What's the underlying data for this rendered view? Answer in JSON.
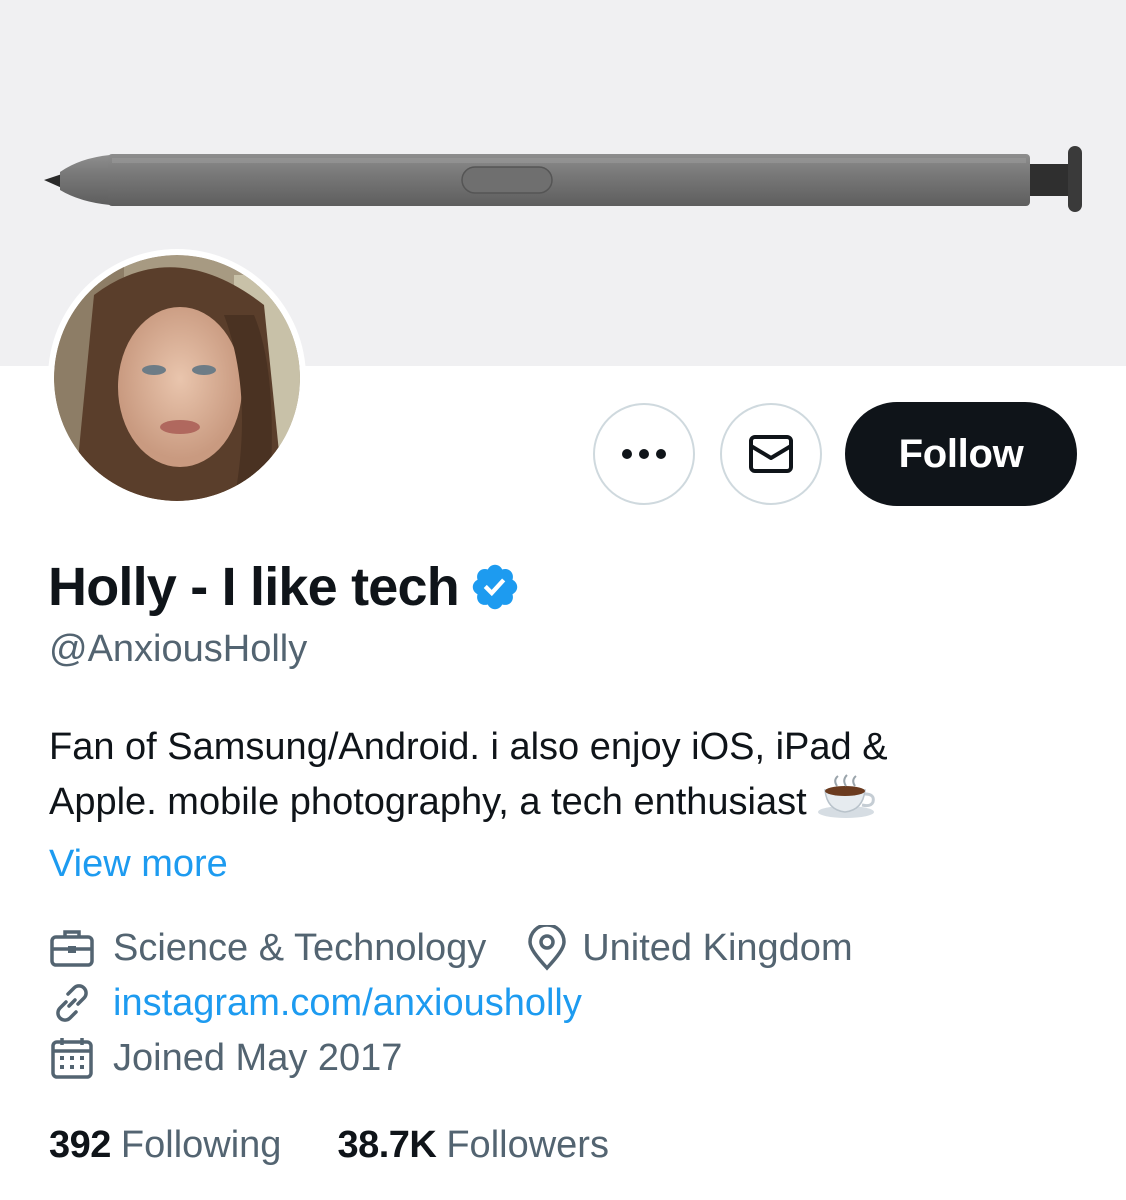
{
  "profile": {
    "display_name": "Holly - I like tech",
    "handle": "@AnxiousHolly",
    "verified": true,
    "bio_line1": "Fan of Samsung/Android. i also enjoy iOS, iPad &",
    "bio_line2": "Apple. mobile photography, a tech enthusiast",
    "bio_emoji": "hot-beverage-icon",
    "view_more": "View more",
    "category": "Science & Technology",
    "location": "United Kingdom",
    "website": "instagram.com/anxiousholly",
    "joined": "Joined May 2017"
  },
  "actions": {
    "more_icon": "more-horizontal-icon",
    "message_icon": "envelope-icon",
    "follow_label": "Follow"
  },
  "stats": {
    "following_count": "392",
    "following_label": "Following",
    "followers_count": "38.7K",
    "followers_label": "Followers"
  },
  "colors": {
    "accent": "#1d9bf0",
    "text_primary": "#0f1419",
    "text_secondary": "#536471",
    "follow_bg": "#0f1419",
    "banner_bg": "#f0f0f2"
  }
}
